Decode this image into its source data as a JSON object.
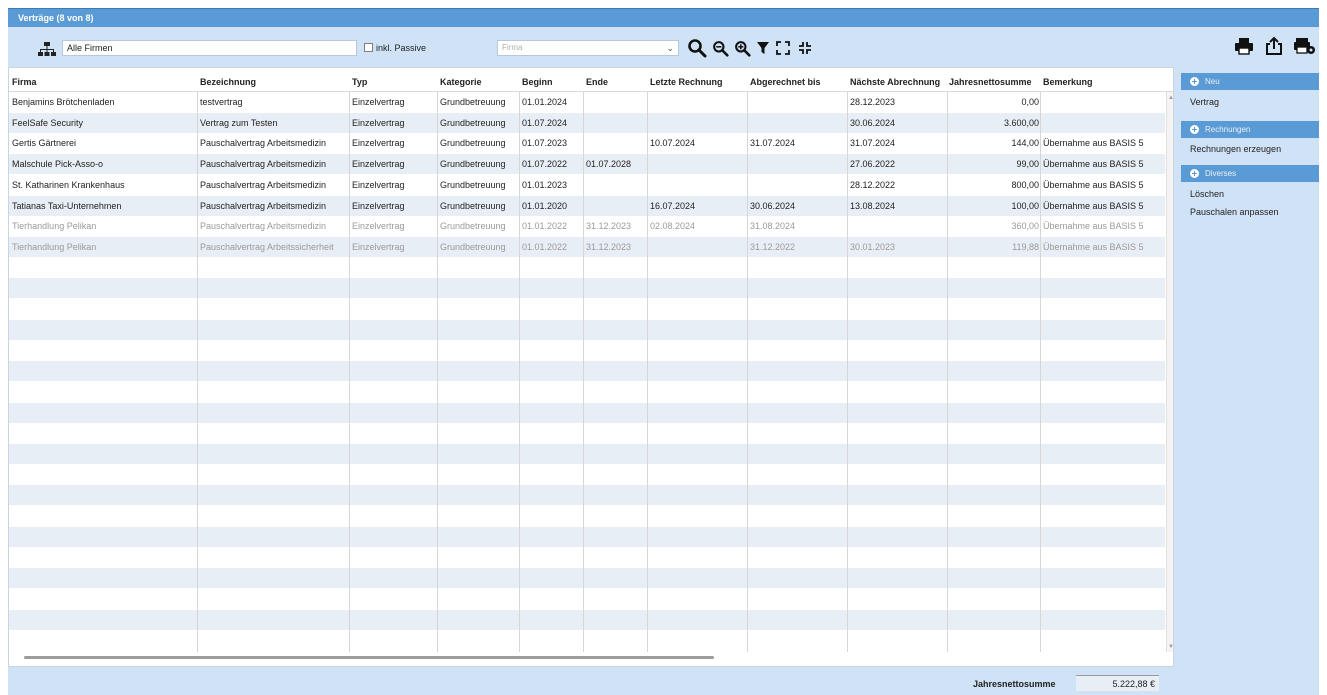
{
  "window": {
    "title": "Verträge (8 von 8)"
  },
  "toolbar": {
    "company_value": "Alle Firmen",
    "passive_label": "inkl. Passive",
    "firma_placeholder": "Firma",
    "icons": [
      "org-chart-icon",
      "search-icon",
      "zoom-out-icon",
      "zoom-in-icon",
      "filter-icon",
      "expand-icon",
      "collapse-icon",
      "print-icon",
      "export-icon",
      "settings-printer-icon"
    ]
  },
  "table": {
    "columns": [
      "Firma",
      "Bezeichnung",
      "Typ",
      "Kategorie",
      "Beginn",
      "Ende",
      "Letzte Rechnung",
      "Abgerechnet bis",
      "Nächste Abrechnung",
      "Jahresnettosumme",
      "Bemerkung"
    ],
    "rows": [
      {
        "passive": false,
        "cells": [
          "Benjamins Brötchenladen",
          "testvertrag",
          "Einzelvertrag",
          "Grundbetreuung",
          "01.01.2024",
          "",
          "",
          "",
          "28.12.2023",
          "0,00",
          ""
        ]
      },
      {
        "passive": false,
        "cells": [
          "FeelSafe Security",
          "Vertrag zum Testen",
          "Einzelvertrag",
          "Grundbetreuung",
          "01.07.2024",
          "",
          "",
          "",
          "30.06.2024",
          "3.600,00",
          ""
        ]
      },
      {
        "passive": false,
        "cells": [
          "Gertis Gärtnerei",
          "Pauschalvertrag Arbeitsmedizin",
          "Einzelvertrag",
          "Grundbetreuung",
          "01.07.2023",
          "",
          "10.07.2024",
          "31.07.2024",
          "31.07.2024",
          "144,00",
          "Übernahme aus BASIS 5"
        ]
      },
      {
        "passive": false,
        "cells": [
          "Malschule Pick-Asso-o",
          "Pauschalvertrag Arbeitsmedizin",
          "Einzelvertrag",
          "Grundbetreuung",
          "01.07.2022",
          "01.07.2028",
          "",
          "",
          "27.06.2022",
          "99,00",
          "Übernahme aus BASIS 5"
        ]
      },
      {
        "passive": false,
        "cells": [
          "St. Katharinen Krankenhaus",
          "Pauschalvertrag Arbeitsmedizin",
          "Einzelvertrag",
          "Grundbetreuung",
          "01.01.2023",
          "",
          "",
          "",
          "28.12.2022",
          "800,00",
          "Übernahme aus BASIS 5"
        ]
      },
      {
        "passive": false,
        "cells": [
          "Tatianas Taxi-Unternehmen",
          "Pauschalvertrag Arbeitsmedizin",
          "Einzelvertrag",
          "Grundbetreuung",
          "01.01.2020",
          "",
          "16.07.2024",
          "30.06.2024",
          "13.08.2024",
          "100,00",
          "Übernahme aus BASIS 5"
        ]
      },
      {
        "passive": true,
        "cells": [
          "Tierhandlung Pelikan",
          "Pauschalvertrag Arbeitsmedizin",
          "Einzelvertrag",
          "Grundbetreuung",
          "01.01.2022",
          "31.12.2023",
          "02.08.2024",
          "31.08.2024",
          "",
          "360,00",
          "Übernahme aus BASIS 5"
        ]
      },
      {
        "passive": true,
        "cells": [
          "Tierhandlung Pelikan",
          "Pauschalvertrag Arbeitssicherheit",
          "Einzelvertrag",
          "Grundbetreuung",
          "01.01.2022",
          "31.12.2023",
          "",
          "31.12.2022",
          "30.01.2023",
          "119,88",
          "Übernahme aus BASIS 5"
        ]
      }
    ]
  },
  "footer": {
    "sum_label": "Jahresnettosumme",
    "sum_value": "5.222,88 €"
  },
  "sidebar": {
    "sections": [
      {
        "title": "Neu",
        "items": [
          "Vertrag"
        ]
      },
      {
        "title": "Rechnungen",
        "items": [
          "Rechnungen erzeugen"
        ]
      },
      {
        "title": "Diverses",
        "items": [
          "Löschen",
          "Pauschalen anpassen"
        ]
      }
    ]
  },
  "colors": {
    "accent": "#5b9bd5",
    "panel": "#cfe2f6",
    "row_alt": "#e8eef5",
    "passive_text": "#9a9a9a"
  }
}
